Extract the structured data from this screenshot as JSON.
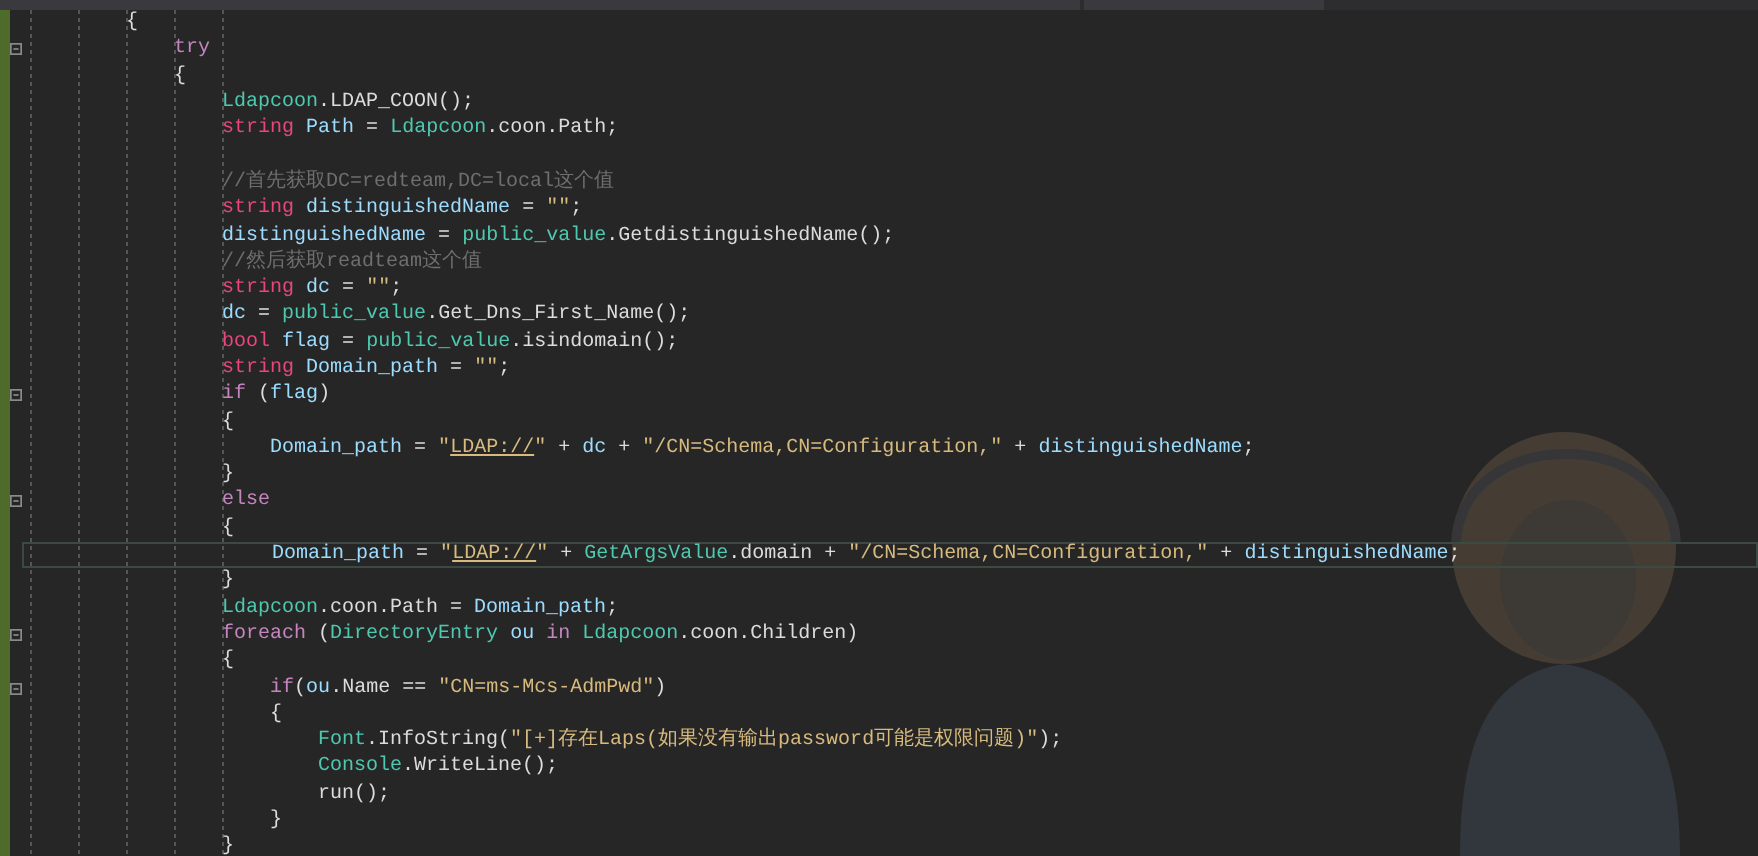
{
  "editor": {
    "lines": [
      {
        "tokens": [
          {
            "kind": "plain",
            "text": "        {"
          }
        ],
        "foldable": false,
        "current": false
      },
      {
        "tokens": [
          {
            "kind": "control",
            "text": "            try"
          }
        ],
        "foldable": true,
        "current": false
      },
      {
        "tokens": [
          {
            "kind": "plain",
            "text": "            {"
          }
        ],
        "foldable": false,
        "current": false
      },
      {
        "tokens": [
          {
            "kind": "class",
            "text": "                Ldapcoon"
          },
          {
            "kind": "plain",
            "text": ".LDAP_COON();"
          }
        ],
        "foldable": false,
        "current": false
      },
      {
        "tokens": [
          {
            "kind": "type",
            "text": "                string "
          },
          {
            "kind": "var",
            "text": "Path"
          },
          {
            "kind": "plain",
            "text": " = "
          },
          {
            "kind": "class",
            "text": "Ldapcoon"
          },
          {
            "kind": "plain",
            "text": ".coon.Path;"
          }
        ],
        "foldable": false,
        "current": false
      },
      {
        "foldable": false,
        "current": false
      },
      {
        "tokens": [
          {
            "kind": "comment",
            "text": "                //首先获取DC=redteam,DC=local这个值"
          }
        ],
        "foldable": false,
        "current": false
      },
      {
        "tokens": [
          {
            "kind": "type",
            "text": "                string "
          },
          {
            "kind": "var",
            "text": "distinguishedName"
          },
          {
            "kind": "plain",
            "text": " = "
          },
          {
            "kind": "string",
            "text": "\"\""
          },
          {
            "kind": "plain",
            "text": ";"
          }
        ],
        "foldable": false,
        "current": false
      },
      {
        "tokens": [
          {
            "kind": "var",
            "text": "                distinguishedName"
          },
          {
            "kind": "plain",
            "text": " = "
          },
          {
            "kind": "class",
            "text": "public_value"
          },
          {
            "kind": "plain",
            "text": ".GetdistinguishedName();"
          }
        ],
        "foldable": false,
        "current": false
      },
      {
        "tokens": [
          {
            "kind": "comment",
            "text": "                //然后获取readteam这个值"
          }
        ],
        "foldable": false,
        "current": false
      },
      {
        "tokens": [
          {
            "kind": "type",
            "text": "                string "
          },
          {
            "kind": "var",
            "text": "dc"
          },
          {
            "kind": "plain",
            "text": " = "
          },
          {
            "kind": "string",
            "text": "\"\""
          },
          {
            "kind": "plain",
            "text": ";"
          }
        ],
        "foldable": false,
        "current": false
      },
      {
        "tokens": [
          {
            "kind": "var",
            "text": "                dc"
          },
          {
            "kind": "plain",
            "text": " = "
          },
          {
            "kind": "class",
            "text": "public_value"
          },
          {
            "kind": "plain",
            "text": ".Get_Dns_First_Name();"
          }
        ],
        "foldable": false,
        "current": false
      },
      {
        "tokens": [
          {
            "kind": "type",
            "text": "                bool "
          },
          {
            "kind": "var",
            "text": "flag"
          },
          {
            "kind": "plain",
            "text": " = "
          },
          {
            "kind": "class",
            "text": "public_value"
          },
          {
            "kind": "plain",
            "text": ".isindomain();"
          }
        ],
        "foldable": false,
        "current": false
      },
      {
        "tokens": [
          {
            "kind": "type",
            "text": "                string "
          },
          {
            "kind": "var",
            "text": "Domain_path"
          },
          {
            "kind": "plain",
            "text": " = "
          },
          {
            "kind": "string",
            "text": "\"\""
          },
          {
            "kind": "plain",
            "text": ";"
          }
        ],
        "foldable": false,
        "current": false
      },
      {
        "tokens": [
          {
            "kind": "control",
            "text": "                if"
          },
          {
            "kind": "plain",
            "text": " ("
          },
          {
            "kind": "var",
            "text": "flag"
          },
          {
            "kind": "plain",
            "text": ")"
          }
        ],
        "foldable": true,
        "current": false
      },
      {
        "tokens": [
          {
            "kind": "plain",
            "text": "                {"
          }
        ],
        "foldable": false,
        "current": false
      },
      {
        "tokens": [
          {
            "kind": "var",
            "text": "                    Domain_path"
          },
          {
            "kind": "plain",
            "text": " = "
          },
          {
            "kind": "string",
            "text": "\""
          },
          {
            "kind": "link",
            "text": "LDAP://"
          },
          {
            "kind": "string",
            "text": "\""
          },
          {
            "kind": "plain",
            "text": " + "
          },
          {
            "kind": "var",
            "text": "dc"
          },
          {
            "kind": "plain",
            "text": " + "
          },
          {
            "kind": "string",
            "text": "\"/CN=Schema,CN=Configuration,\""
          },
          {
            "kind": "plain",
            "text": " + "
          },
          {
            "kind": "var",
            "text": "distinguishedName"
          },
          {
            "kind": "plain",
            "text": ";"
          }
        ],
        "foldable": false,
        "current": false
      },
      {
        "tokens": [
          {
            "kind": "plain",
            "text": "                }"
          }
        ],
        "foldable": false,
        "current": false
      },
      {
        "tokens": [
          {
            "kind": "control",
            "text": "                else"
          }
        ],
        "foldable": true,
        "current": false
      },
      {
        "tokens": [
          {
            "kind": "plain",
            "text": "                {"
          }
        ],
        "foldable": false,
        "current": false
      },
      {
        "tokens": [
          {
            "kind": "var",
            "text": "                    Domain_path"
          },
          {
            "kind": "plain",
            "text": " = "
          },
          {
            "kind": "string",
            "text": "\""
          },
          {
            "kind": "link",
            "text": "LDAP://"
          },
          {
            "kind": "string",
            "text": "\""
          },
          {
            "kind": "plain",
            "text": " + "
          },
          {
            "kind": "class",
            "text": "GetArgsValue"
          },
          {
            "kind": "plain",
            "text": ".domain + "
          },
          {
            "kind": "string",
            "text": "\"/CN=Schema,CN=Configuration,\""
          },
          {
            "kind": "plain",
            "text": " + "
          },
          {
            "kind": "var",
            "text": "distinguishedName"
          },
          {
            "kind": "plain",
            "text": ";"
          }
        ],
        "foldable": false,
        "current": true
      },
      {
        "tokens": [
          {
            "kind": "plain",
            "text": "                }"
          }
        ],
        "foldable": false,
        "current": false
      },
      {
        "tokens": [
          {
            "kind": "class",
            "text": "                Ldapcoon"
          },
          {
            "kind": "plain",
            "text": ".coon.Path = "
          },
          {
            "kind": "var",
            "text": "Domain_path"
          },
          {
            "kind": "plain",
            "text": ";"
          }
        ],
        "foldable": false,
        "current": false
      },
      {
        "tokens": [
          {
            "kind": "control",
            "text": "                foreach"
          },
          {
            "kind": "plain",
            "text": " ("
          },
          {
            "kind": "class",
            "text": "DirectoryEntry "
          },
          {
            "kind": "var",
            "text": "ou "
          },
          {
            "kind": "control",
            "text": "in "
          },
          {
            "kind": "class",
            "text": "Ldapcoon"
          },
          {
            "kind": "plain",
            "text": ".coon.Children)"
          }
        ],
        "foldable": true,
        "current": false
      },
      {
        "tokens": [
          {
            "kind": "plain",
            "text": "                {"
          }
        ],
        "foldable": false,
        "current": false
      },
      {
        "tokens": [
          {
            "kind": "control",
            "text": "                    if"
          },
          {
            "kind": "plain",
            "text": "("
          },
          {
            "kind": "var",
            "text": "ou"
          },
          {
            "kind": "plain",
            "text": ".Name == "
          },
          {
            "kind": "string",
            "text": "\"CN=ms-Mcs-AdmPwd\""
          },
          {
            "kind": "plain",
            "text": ")"
          }
        ],
        "foldable": true,
        "current": false
      },
      {
        "tokens": [
          {
            "kind": "plain",
            "text": "                    {"
          }
        ],
        "foldable": false,
        "current": false
      },
      {
        "tokens": [
          {
            "kind": "class",
            "text": "                        Font"
          },
          {
            "kind": "plain",
            "text": ".InfoString("
          },
          {
            "kind": "string",
            "text": "\"[+]存在Laps(如果没有输出password可能是权限问题)\""
          },
          {
            "kind": "plain",
            "text": ");"
          }
        ],
        "foldable": false,
        "current": false
      },
      {
        "tokens": [
          {
            "kind": "class",
            "text": "                        Console"
          },
          {
            "kind": "plain",
            "text": ".WriteLine();"
          }
        ],
        "foldable": false,
        "current": false
      },
      {
        "tokens": [
          {
            "kind": "plain",
            "text": "                        run();"
          }
        ],
        "foldable": false,
        "current": false
      },
      {
        "tokens": [
          {
            "kind": "plain",
            "text": "                    }"
          }
        ],
        "foldable": false,
        "current": false
      },
      {
        "tokens": [
          {
            "kind": "plain",
            "text": "                }"
          }
        ],
        "foldable": false,
        "current": false
      }
    ]
  }
}
